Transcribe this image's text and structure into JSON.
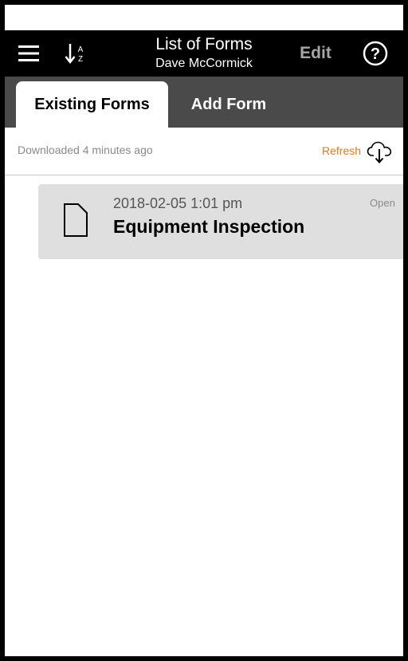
{
  "nav": {
    "title": "List of Forms",
    "subtitle": "Dave McCormick",
    "edit_label": "Edit",
    "icons": [
      "menu-icon",
      "sort-az-icon",
      "help-icon"
    ]
  },
  "tabs": [
    {
      "label": "Existing Forms",
      "active": true
    },
    {
      "label": "Add Form",
      "active": false
    }
  ],
  "info": {
    "downloaded_text": "Downloaded 4 minutes ago",
    "refresh_label": "Refresh"
  },
  "forms": [
    {
      "date": "2018-02-05 1:01 pm",
      "title": "Equipment Inspection",
      "status": "Open"
    }
  ],
  "colors": {
    "nav_bg": "#000000",
    "tab_bar_bg": "#4a4a4a",
    "refresh_accent": "#e07a1f",
    "card_bg": "#dfdfe0",
    "edit_disabled": "#a6a6a6"
  }
}
